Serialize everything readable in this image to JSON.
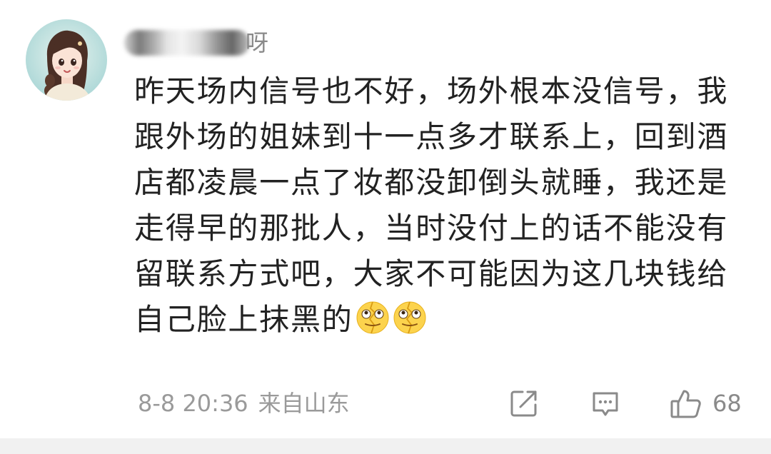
{
  "comment": {
    "avatar_icon": "avatar-girl-illustration",
    "username": "呀",
    "text": "昨天场内信号也不好，场外根本没信号，我跟外场的姐妹到十一点多才联系上，回到酒店都凌晨一点了妆都没卸倒头就睡，我还是走得早的那批人，当时没付上的话不能没有留联系方式吧，大家不可能因为这几块钱给自己脸上抹黑的",
    "emojis": [
      "cracking-face-emoji",
      "cracking-face-emoji"
    ],
    "timestamp": "8-8 20:36",
    "location": "来自山东",
    "actions": {
      "share_icon": "share-icon",
      "reply_icon": "comment-icon",
      "like_icon": "thumbs-up-icon",
      "like_count": "68"
    }
  },
  "colors": {
    "text": "#222222",
    "meta": "#9a9a9a",
    "icon": "#8a8a8a",
    "footer": "#f1f1f1"
  }
}
